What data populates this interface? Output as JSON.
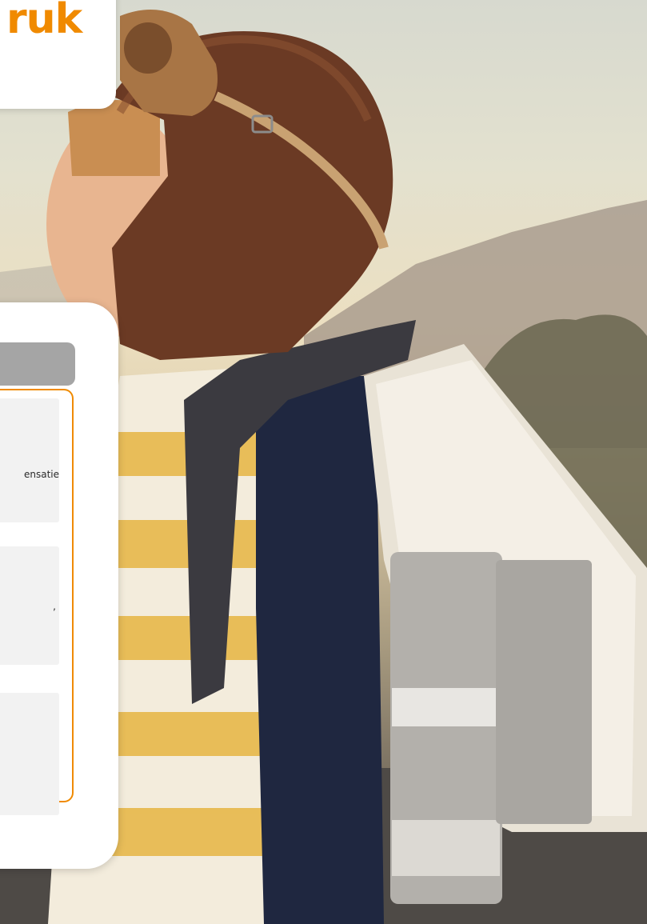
{
  "title": {
    "text": "ruk"
  },
  "panel": {
    "cards": [
      {
        "text": "ensatie"
      },
      {
        "text": ","
      },
      {
        "text": ""
      }
    ]
  },
  "colors": {
    "accent": "#f08a00",
    "panel_header": "#a5a5a5",
    "card_bg": "#f2f2f2"
  }
}
